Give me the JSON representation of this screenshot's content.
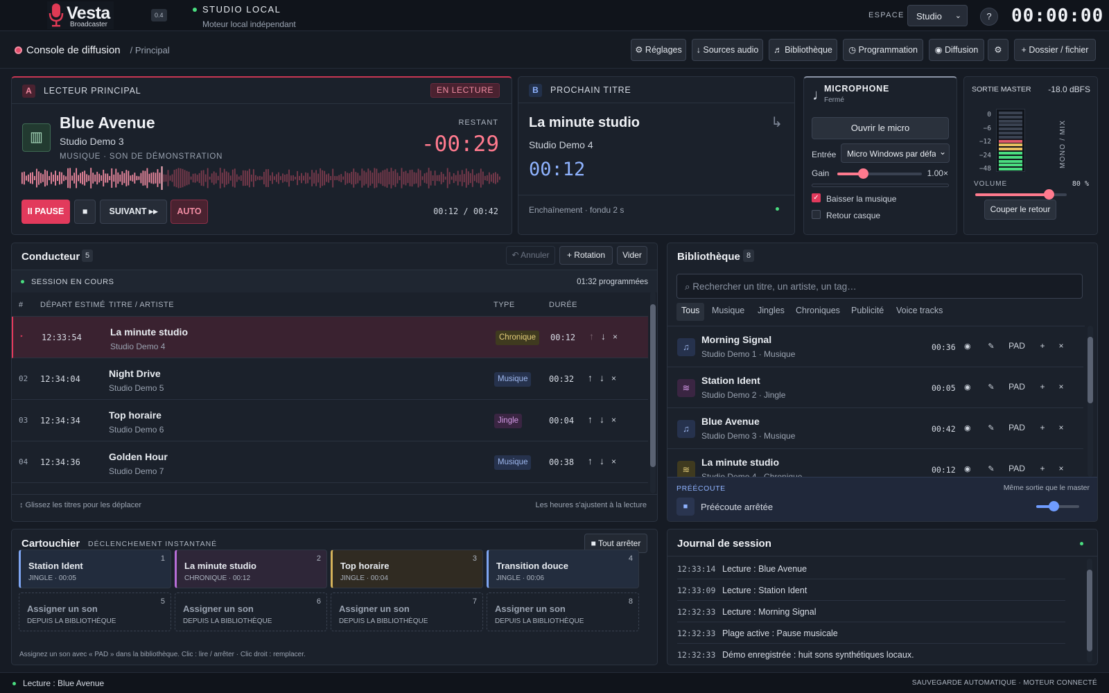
{
  "topbar": {
    "brand": "Vesta",
    "brand_sub": "Broadcaster",
    "version": "0.4",
    "studio_title": "STUDIO LOCAL",
    "studio_sub": "Moteur local indépendant",
    "espace_label": "ESPACE",
    "espace_value": "Studio",
    "help": "?",
    "clock": "00:00:00"
  },
  "subbar": {
    "title": "Console de diffusion",
    "crumb": "/ Principal",
    "buttons": [
      "⚙ Réglages",
      "↓ Sources audio",
      "♬ Bibliothèque",
      "◷ Programmation",
      "◉ Diffusion",
      "⚙",
      "+ Dossier / fichier"
    ]
  },
  "player": {
    "badge": "A",
    "label": "LECTEUR PRINCIPAL",
    "status": "EN LECTURE",
    "title": "Blue Avenue",
    "artist": "Studio Demo 3",
    "meta": "MUSIQUE · SON DE DÉMONSTRATION",
    "remaining_label": "RESTANT",
    "remaining": "-00:29",
    "pause": "II PAUSE",
    "stop": "■",
    "next": "SUIVANT ▸▸",
    "auto": "AUTO",
    "time": "00:12 / 00:42",
    "progress": 0.29
  },
  "next": {
    "badge": "B",
    "label": "PROCHAIN TITRE",
    "title": "La minute studio",
    "artist": "Studio Demo 4",
    "time": "00:12",
    "footer": "Enchaînement · fondu 2 s"
  },
  "mic": {
    "label": "MICROPHONE",
    "state": "Fermé",
    "open_btn": "Ouvrir le micro",
    "input_label": "Entrée",
    "input_value": "Micro Windows par défaut",
    "gain_label": "Gain",
    "gain_value": "1.00×",
    "gain_level": 0.3,
    "duck_label": "Baisser la musique",
    "duck": true,
    "monitor_label": "Retour casque",
    "monitor": false
  },
  "master": {
    "label": "SORTIE MASTER",
    "level": "-18.0 dBFS",
    "scale": [
      "0",
      "−6",
      "−12",
      "−24",
      "−48"
    ],
    "side": "MONO / MIX",
    "volume_label": "VOLUME",
    "volume_value": "80 %",
    "volume": 0.8,
    "mute_btn": "Couper le retour"
  },
  "rundown": {
    "title": "Conducteur",
    "count": "5",
    "annuler": "↶ Annuler",
    "rotation": "+ Rotation",
    "vider": "Vider",
    "session": "SESSION EN COURS",
    "scheduled": "01:32 programmées",
    "headers": [
      "#",
      "DÉPART ESTIMÉ",
      "TITRE / ARTISTE",
      "TYPE",
      "DURÉE"
    ],
    "rows": [
      {
        "num": "▸",
        "start": "12:33:54",
        "title": "La minute studio",
        "artist": "Studio Demo 4",
        "type": "Chronique",
        "dur": "00:12"
      },
      {
        "num": "02",
        "start": "12:34:04",
        "title": "Night Drive",
        "artist": "Studio Demo 5",
        "type": "Musique",
        "dur": "00:32"
      },
      {
        "num": "03",
        "start": "12:34:34",
        "title": "Top horaire",
        "artist": "Studio Demo 6",
        "type": "Jingle",
        "dur": "00:04"
      },
      {
        "num": "04",
        "start": "12:34:36",
        "title": "Golden Hour",
        "artist": "Studio Demo 7",
        "type": "Musique",
        "dur": "00:38"
      },
      {
        "num": "",
        "start": "",
        "title": "Transition douce",
        "artist": "",
        "type": "",
        "dur": ""
      }
    ],
    "footer_left": "↕ Glissez les titres pour les déplacer",
    "footer_right": "Les heures s'ajustent à la lecture"
  },
  "library": {
    "title": "Bibliothèque",
    "count": "8",
    "search_placeholder": "⌕ Rechercher un titre, un artiste, un tag…",
    "tabs": [
      "Tous",
      "Musique",
      "Jingles",
      "Chroniques",
      "Publicité",
      "Voice tracks"
    ],
    "items": [
      {
        "icon": "♫",
        "title": "Morning Signal",
        "sub": "Studio Demo 1 · Musique",
        "dur": "00:36"
      },
      {
        "icon": "≋",
        "title": "Station Ident",
        "sub": "Studio Demo 2 · Jingle",
        "dur": "00:05"
      },
      {
        "icon": "♫",
        "title": "Blue Avenue",
        "sub": "Studio Demo 3 · Musique",
        "dur": "00:42"
      },
      {
        "icon": "≋",
        "title": "La minute studio",
        "sub": "Studio Demo 4 · Chronique",
        "dur": "00:12"
      }
    ],
    "pad": "PAD",
    "preview_label": "PRÉÉCOUTE",
    "preview_out": "Même sortie que le master",
    "preview_state": "Préécoute arrêtée",
    "preview_volume": 0.4
  },
  "cart": {
    "title": "Cartouchier",
    "sub": "DÉCLENCHEMENT INSTANTANÉ",
    "stop_all": "■ Tout arrêter",
    "slots": [
      {
        "n": "1",
        "title": "Station Ident",
        "sub": "JINGLE · 00:05"
      },
      {
        "n": "2",
        "title": "La minute studio",
        "sub": "CHRONIQUE · 00:12"
      },
      {
        "n": "3",
        "title": "Top horaire",
        "sub": "JINGLE · 00:04"
      },
      {
        "n": "4",
        "title": "Transition douce",
        "sub": "JINGLE · 00:06"
      },
      {
        "n": "5",
        "title": "Assigner un son",
        "sub": "DEPUIS LA BIBLIOTHÈQUE"
      },
      {
        "n": "6",
        "title": "Assigner un son",
        "sub": "DEPUIS LA BIBLIOTHÈQUE"
      },
      {
        "n": "7",
        "title": "Assigner un son",
        "sub": "DEPUIS LA BIBLIOTHÈQUE"
      },
      {
        "n": "8",
        "title": "Assigner un son",
        "sub": "DEPUIS LA BIBLIOTHÈQUE"
      }
    ],
    "hint": "Assignez un son avec « PAD » dans la bibliothèque. Clic : lire / arrêter · Clic droit : remplacer."
  },
  "journal": {
    "title": "Journal de session",
    "rows": [
      {
        "t": "12:33:14",
        "m": "Lecture : Blue Avenue"
      },
      {
        "t": "12:33:09",
        "m": "Lecture : Station Ident"
      },
      {
        "t": "12:32:33",
        "m": "Lecture : Morning Signal"
      },
      {
        "t": "12:32:33",
        "m": "Plage active : Pause musicale"
      },
      {
        "t": "12:32:33",
        "m": "Démo enregistrée : huit sons synthétiques locaux."
      }
    ]
  },
  "status": {
    "left": "Lecture : Blue Avenue",
    "right": "SAUVEGARDE AUTOMATIQUE · MOTEUR CONNECTÉ"
  },
  "colors": {
    "accent": "#e23a5c",
    "bg": "#161b24",
    "panel": "#1b212b",
    "next_blue": "#8fb3ff",
    "green": "#4ade80"
  }
}
